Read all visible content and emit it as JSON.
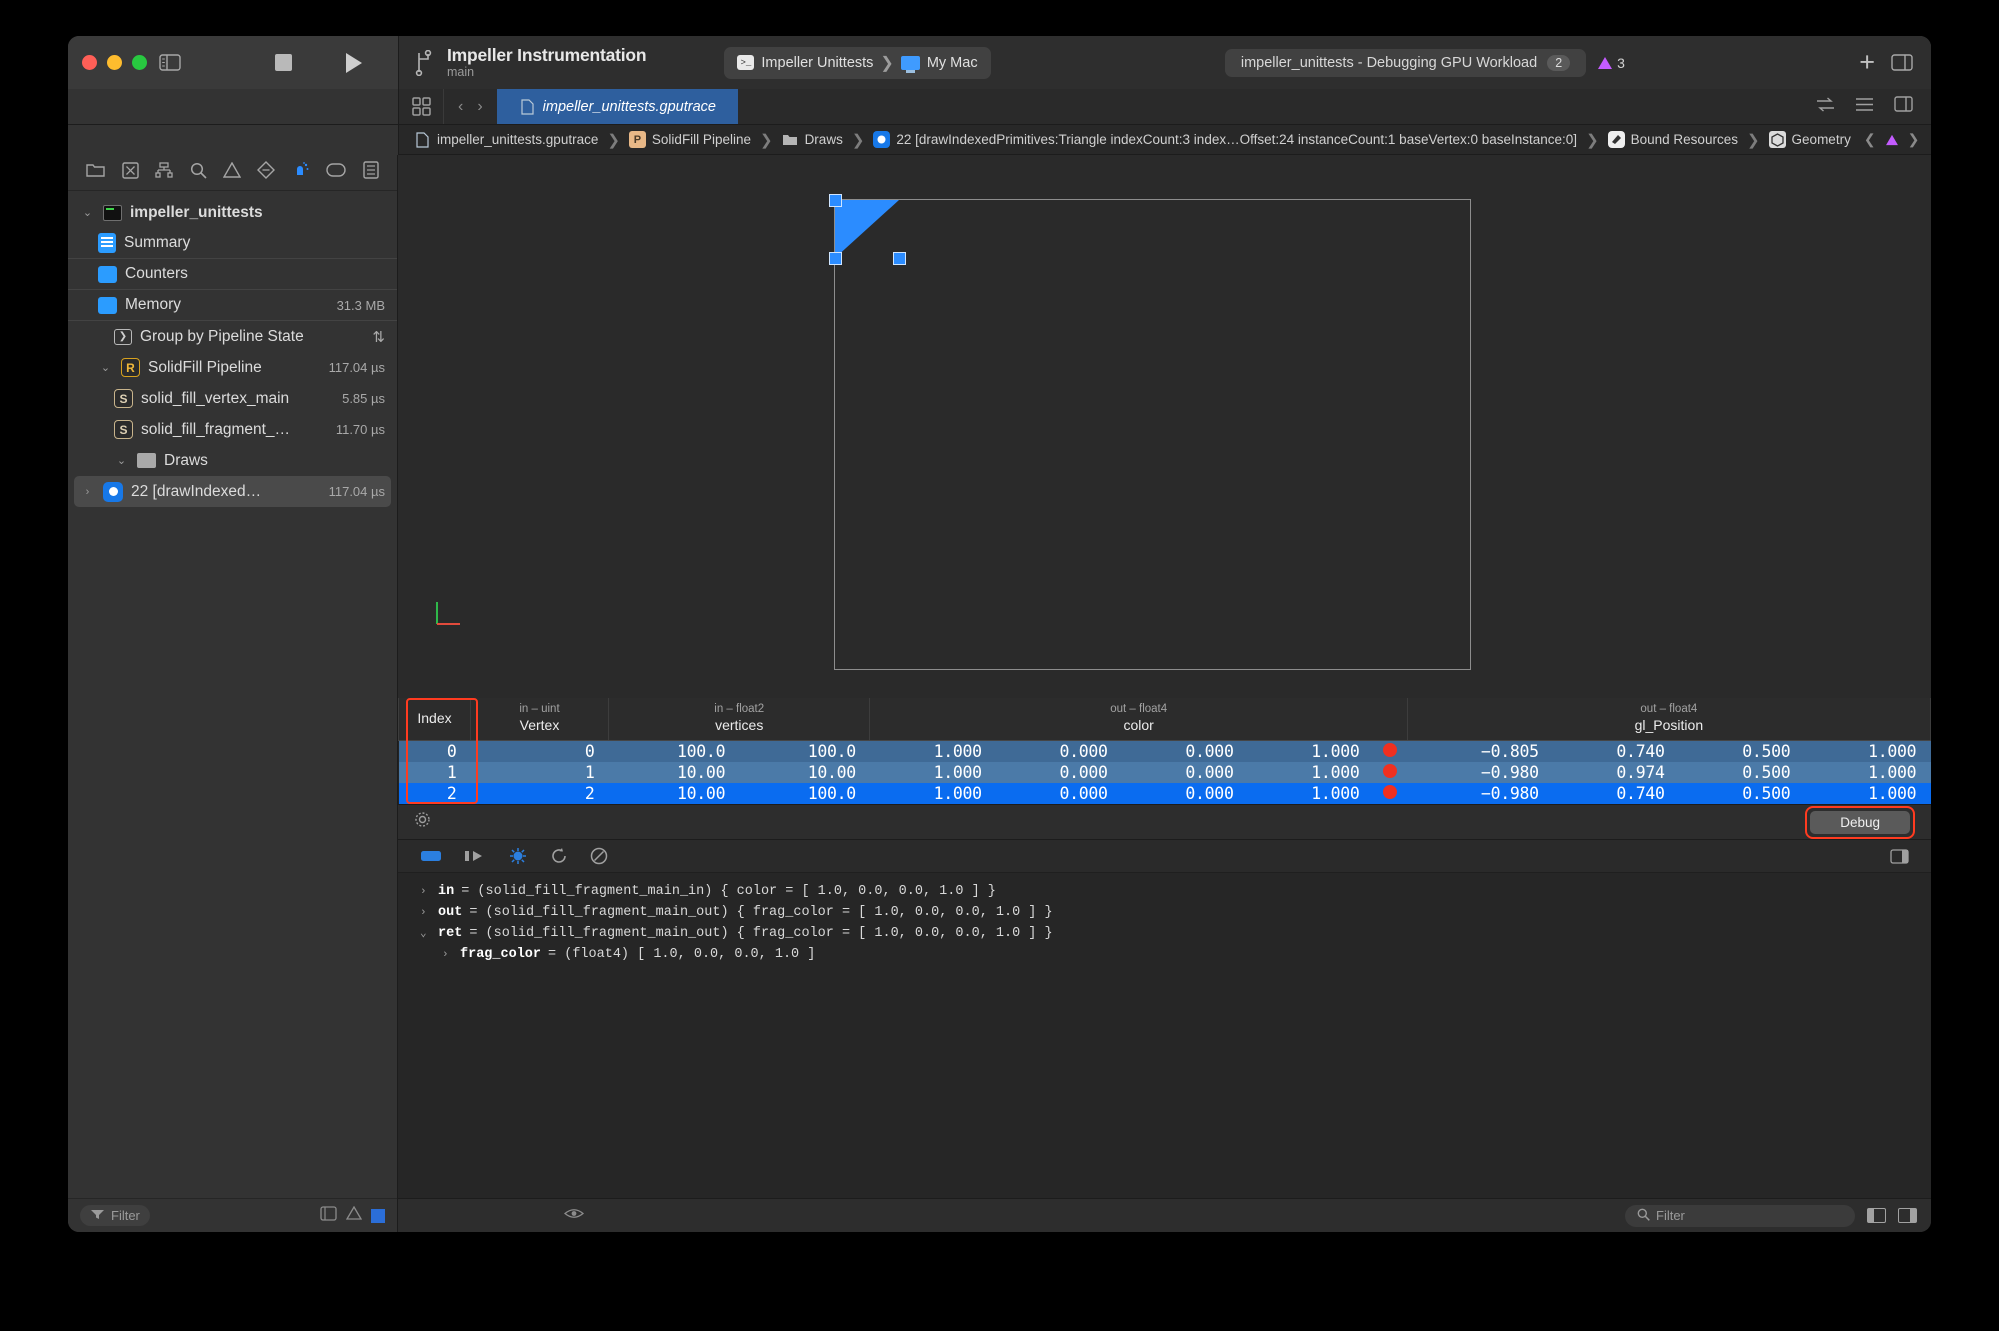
{
  "titlebar": {
    "scheme_title": "Impeller Instrumentation",
    "scheme_branch": "main",
    "destination_scheme": "Impeller Unittests",
    "destination_device": "My Mac",
    "status_text": "impeller_unittests - Debugging GPU Workload",
    "status_count": "2",
    "warning_count": "3",
    "add_label": "+"
  },
  "tabbar": {
    "file_tab": "impeller_unittests.gputrace",
    "back_arrow": "‹",
    "forward_arrow": "›"
  },
  "breadcrumb": {
    "items": [
      {
        "label": "impeller_unittests.gputrace",
        "icon": "document-icon"
      },
      {
        "label": "SolidFill Pipeline",
        "icon": "pipeline-icon"
      },
      {
        "label": "Draws",
        "icon": "folder-icon"
      },
      {
        "label": "22 [drawIndexedPrimitives:Triangle indexCount:3 index…Offset:24 instanceCount:1 baseVertex:0 baseInstance:0]",
        "icon": "draw-call-icon"
      },
      {
        "label": "Bound Resources",
        "icon": "resources-icon"
      },
      {
        "label": "Geometry",
        "icon": "geometry-icon"
      }
    ],
    "separator": "❯"
  },
  "sidebar": {
    "tools": [
      "folder-icon",
      "close-box-icon",
      "hierarchy-icon",
      "search-icon",
      "warning-icon",
      "diamond-icon",
      "debug-gauge-icon",
      "tag-icon",
      "report-icon"
    ],
    "items": [
      {
        "label": "impeller_unittests",
        "value": "",
        "icon": "project-icon",
        "chevron": "⌄",
        "indent": 0,
        "bold": true,
        "separator": false,
        "selected": false
      },
      {
        "label": "Summary",
        "value": "",
        "icon": "summary-icon",
        "chevron": "",
        "indent": 1,
        "bold": false,
        "separator": true,
        "selected": false
      },
      {
        "label": "Counters",
        "value": "",
        "icon": "counters-icon",
        "chevron": "",
        "indent": 1,
        "bold": false,
        "separator": true,
        "selected": false
      },
      {
        "label": "Memory",
        "value": "31.3 MB",
        "icon": "memory-icon",
        "chevron": "",
        "indent": 1,
        "bold": false,
        "separator": true,
        "selected": false
      },
      {
        "label": "Group by Pipeline State",
        "value": "⇅",
        "icon": "group-icon",
        "chevron": "",
        "indent": 2,
        "bold": false,
        "separator": false,
        "selected": false
      },
      {
        "label": "SolidFill Pipeline",
        "value": "117.04 µs",
        "icon": "render-pipeline-icon",
        "chevron": "⌄",
        "indent": 1,
        "bold": false,
        "separator": false,
        "selected": false
      },
      {
        "label": "solid_fill_vertex_main",
        "value": "5.85 µs",
        "icon": "shader-icon",
        "chevron": "",
        "indent": 2,
        "bold": false,
        "separator": false,
        "selected": false
      },
      {
        "label": "solid_fill_fragment_…",
        "value": "11.70 µs",
        "icon": "shader-icon",
        "chevron": "",
        "indent": 2,
        "bold": false,
        "separator": false,
        "selected": false
      },
      {
        "label": "Draws",
        "value": "",
        "icon": "folder-icon",
        "chevron": "⌄",
        "indent": 2,
        "bold": false,
        "separator": false,
        "selected": false
      },
      {
        "label": "22 [drawIndexed…",
        "value": "117.04 µs",
        "icon": "draw-call-icon",
        "chevron": "›",
        "indent": 3,
        "bold": false,
        "separator": false,
        "selected": true
      }
    ],
    "filter_placeholder": "Filter"
  },
  "table": {
    "columns": [
      {
        "type": "",
        "name": "Index",
        "span": 1
      },
      {
        "type": "in – uint",
        "name": "Vertex",
        "span": 1
      },
      {
        "type": "in – float2",
        "name": "vertices",
        "span": 2
      },
      {
        "type": "out – float4",
        "name": "color",
        "span": 5
      },
      {
        "type": "out – float4",
        "name": "gl_Position",
        "span": 4
      },
      {
        "type": "",
        "name": "",
        "span": 1
      }
    ],
    "rows": [
      {
        "index": "0",
        "vertex": "0",
        "vertices": [
          "100.0",
          "100.0"
        ],
        "color": [
          "1.000",
          "0.000",
          "0.000",
          "1.000"
        ],
        "swatch": "#f03020",
        "gl_position": [
          "−0.805",
          "0.740",
          "0.500",
          "1.000"
        ],
        "state": "even"
      },
      {
        "index": "1",
        "vertex": "1",
        "vertices": [
          "10.00",
          "10.00"
        ],
        "color": [
          "1.000",
          "0.000",
          "0.000",
          "1.000"
        ],
        "swatch": "#f03020",
        "gl_position": [
          "−0.980",
          "0.974",
          "0.500",
          "1.000"
        ],
        "state": "odd"
      },
      {
        "index": "2",
        "vertex": "2",
        "vertices": [
          "10.00",
          "100.0"
        ],
        "color": [
          "1.000",
          "0.000",
          "0.000",
          "1.000"
        ],
        "swatch": "#f03020",
        "gl_position": [
          "−0.980",
          "0.740",
          "0.500",
          "1.000"
        ],
        "state": "selected"
      }
    ]
  },
  "debugbar": {
    "debug_button": "Debug",
    "gear_icon": "gear-icon"
  },
  "console": {
    "lines": [
      {
        "disclosure": "›",
        "name": "in",
        "text": " = (solid_fill_fragment_main_in) { color = [ 1.0, 0.0, 0.0, 1.0 ] }",
        "indent": 0
      },
      {
        "disclosure": "›",
        "name": "out",
        "text": " = (solid_fill_fragment_main_out) { frag_color = [ 1.0, 0.0, 0.0, 1.0 ] }",
        "indent": 0
      },
      {
        "disclosure": "⌄",
        "name": "ret",
        "text": " = (solid_fill_fragment_main_out) { frag_color = [ 1.0, 0.0, 0.0, 1.0 ] }",
        "indent": 0
      },
      {
        "disclosure": "›",
        "name": "frag_color",
        "text": " = (float4) [ 1.0, 0.0, 0.0, 1.0 ]",
        "indent": 1
      }
    ]
  },
  "bottombar": {
    "filter_placeholder": "Filter"
  },
  "colors": {
    "accent_blue": "#2b8cff",
    "selection_blue": "#0a6cf0",
    "row_even": "#3f6a96",
    "row_odd": "#4b7aa8",
    "highlight_red": "#ff3b20",
    "swatch_red": "#f03020",
    "warning_purple": "#c45cff"
  }
}
